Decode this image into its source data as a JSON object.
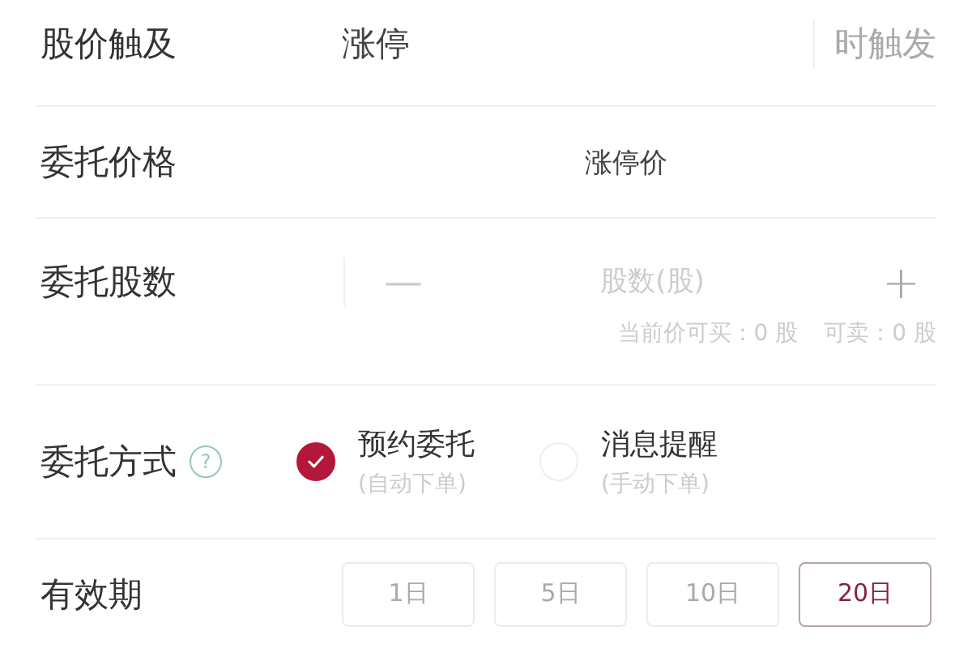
{
  "trigger": {
    "label": "股价触及",
    "value": "涨停",
    "suffix": "时触发"
  },
  "price": {
    "label": "委托价格",
    "value": "涨停价"
  },
  "quantity": {
    "label": "委托股数",
    "minus": "—",
    "placeholder": "股数(股)",
    "plus": "+",
    "buyable": "当前价可买：0 股",
    "sellable": "可卖：0 股"
  },
  "method": {
    "label": "委托方式",
    "help": "?",
    "options": [
      {
        "title": "预约委托",
        "subtitle": "(自动下单)",
        "selected": true
      },
      {
        "title": "消息提醒",
        "subtitle": "(手动下单)",
        "selected": false
      }
    ]
  },
  "validity": {
    "label": "有效期",
    "options": [
      {
        "label": "1日",
        "selected": false
      },
      {
        "label": "5日",
        "selected": false
      },
      {
        "label": "10日",
        "selected": false
      },
      {
        "label": "20日",
        "selected": true
      }
    ]
  }
}
